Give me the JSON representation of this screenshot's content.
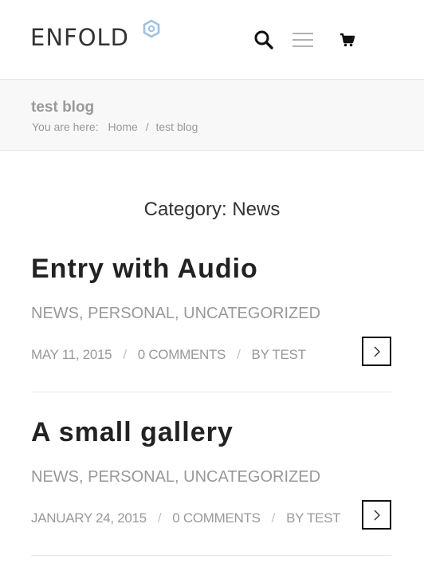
{
  "header": {
    "logo_text": "ENFOLD",
    "icons": [
      "search-icon",
      "hamburger-menu-icon",
      "shopping-cart-icon"
    ],
    "accent_color": "#9cc2e5"
  },
  "title_bar": {
    "page_title": "test blog",
    "breadcrumb": {
      "prefix": "You are here:",
      "items": [
        "Home",
        "test blog"
      ],
      "separator": "/"
    }
  },
  "main": {
    "category_heading": "Category: News",
    "entries": [
      {
        "title": "Entry with Audio",
        "categories": "NEWS, PERSONAL, UNCATEGORIZED",
        "date": "MAY 11, 2015",
        "comments": "0 COMMENTS",
        "author": "BY TEST",
        "meta_separator": "/"
      },
      {
        "title": "A small gallery",
        "categories": "NEWS, PERSONAL, UNCATEGORIZED",
        "date": "JANUARY 24, 2015",
        "comments": "0 COMMENTS",
        "author": "BY TEST",
        "meta_separator": "/"
      }
    ]
  }
}
